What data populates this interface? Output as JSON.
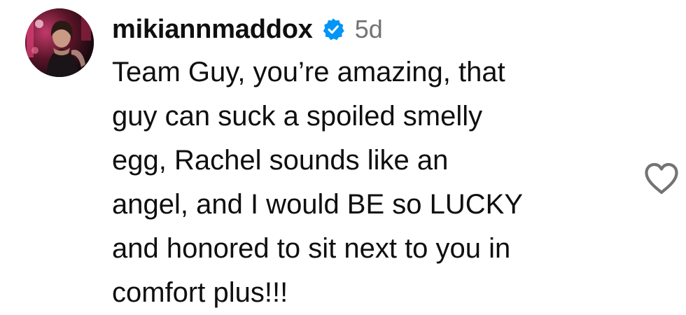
{
  "comment": {
    "username": "mikiannmaddox",
    "verified": true,
    "timestamp": "5d",
    "text_lines": [
      "Team Guy, you’re amazing, that",
      "guy can suck a spoiled smelly",
      "egg, Rachel sounds like an",
      "angel, and I would BE so LUCKY",
      "and honored to sit next to you in",
      "comfort plus!!!"
    ],
    "avatar_icon": "profile-photo",
    "verified_icon": "verified-badge-icon",
    "like_icon": "heart-outline-icon"
  },
  "colors": {
    "username": "#0f0f0f",
    "text": "#0f0f0f",
    "timestamp": "#737373",
    "verified_badge": "#0095f6",
    "like_icon": "#737373",
    "background": "#ffffff"
  }
}
